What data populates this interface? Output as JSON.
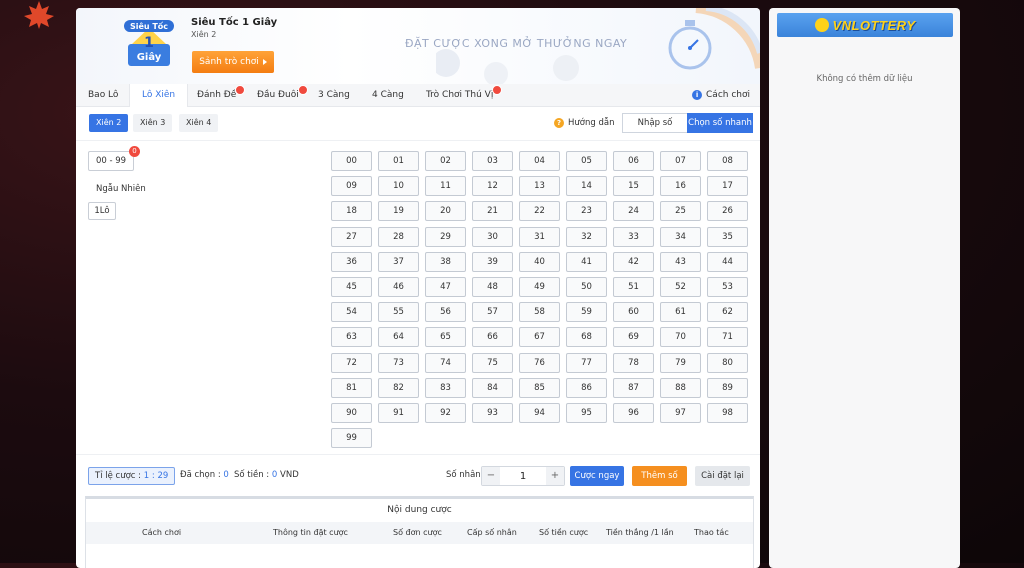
{
  "game": {
    "title": "Siêu Tốc 1 Giây",
    "subtitle": "Xiên 2",
    "logo_text_top": "Siêu Tốc",
    "logo_text_num": "1",
    "logo_text_bottom": "Giây",
    "lobby_button": "Sảnh trò chơi"
  },
  "header": {
    "slogan": "ĐẶT CƯỢC XONG MỞ THƯỞNG NGAY"
  },
  "tabs": [
    {
      "label": "Bao Lô",
      "badge": false
    },
    {
      "label": "Lô Xiên",
      "badge": false,
      "active": true
    },
    {
      "label": "Đánh Đề",
      "badge": true
    },
    {
      "label": "Đầu Đuôi",
      "badge": true
    },
    {
      "label": "3 Càng",
      "badge": false
    },
    {
      "label": "4 Càng",
      "badge": false
    },
    {
      "label": "Trò Chơi Thú Vị",
      "badge": true
    }
  ],
  "how_to_play": "Cách chơi",
  "subtabs": [
    "Xiên 2",
    "Xiên 3",
    "Xiên 4"
  ],
  "guide": "Hướng dẫn",
  "modes": {
    "manual": "Nhập số",
    "quick": "Chọn số nhanh"
  },
  "left": {
    "range": "00 - 99",
    "range_count": "0",
    "random_label": "Ngẫu Nhiên",
    "random_button": "1Lô"
  },
  "numbers": [
    "00",
    "01",
    "02",
    "03",
    "04",
    "05",
    "06",
    "07",
    "08",
    "09",
    "10",
    "11",
    "12",
    "13",
    "14",
    "15",
    "16",
    "17",
    "18",
    "19",
    "20",
    "21",
    "22",
    "23",
    "24",
    "25",
    "26",
    "27",
    "28",
    "29",
    "30",
    "31",
    "32",
    "33",
    "34",
    "35",
    "36",
    "37",
    "38",
    "39",
    "40",
    "41",
    "42",
    "43",
    "44",
    "45",
    "46",
    "47",
    "48",
    "49",
    "50",
    "51",
    "52",
    "53",
    "54",
    "55",
    "56",
    "57",
    "58",
    "59",
    "60",
    "61",
    "62",
    "63",
    "64",
    "65",
    "66",
    "67",
    "68",
    "69",
    "70",
    "71",
    "72",
    "73",
    "74",
    "75",
    "76",
    "77",
    "78",
    "79",
    "80",
    "81",
    "82",
    "83",
    "84",
    "85",
    "86",
    "87",
    "88",
    "89",
    "90",
    "91",
    "92",
    "93",
    "94",
    "95",
    "96",
    "97",
    "98",
    "99"
  ],
  "footer": {
    "ratio_label": "Tỉ lệ cược :",
    "ratio_value": "1 : 29",
    "selected_label": "Đã chọn :",
    "selected_value": "0",
    "amount_label": "Số tiền :",
    "amount_value": "0",
    "amount_unit": "VND",
    "multiplier_label": "Số nhân :",
    "multiplier_minus": "−",
    "multiplier_value": "1",
    "multiplier_plus": "+",
    "bet_button": "Cược ngay",
    "add_button": "Thêm số",
    "reset_button": "Cài đặt lại"
  },
  "bets": {
    "title": "Nội dung cược",
    "columns": [
      "Cách chơi",
      "Thông tin đặt cược",
      "Số đơn cược",
      "Cấp số nhân",
      "Số tiền cược",
      "Tiền thắng /1 lần",
      "Thao tác"
    ]
  },
  "sidebar": {
    "brand": "VNLOTTERY",
    "empty": "Không có thêm dữ liệu"
  },
  "colors": {
    "accent": "#3674e4",
    "orange": "#f58f1f",
    "badge": "#f04a3e"
  }
}
